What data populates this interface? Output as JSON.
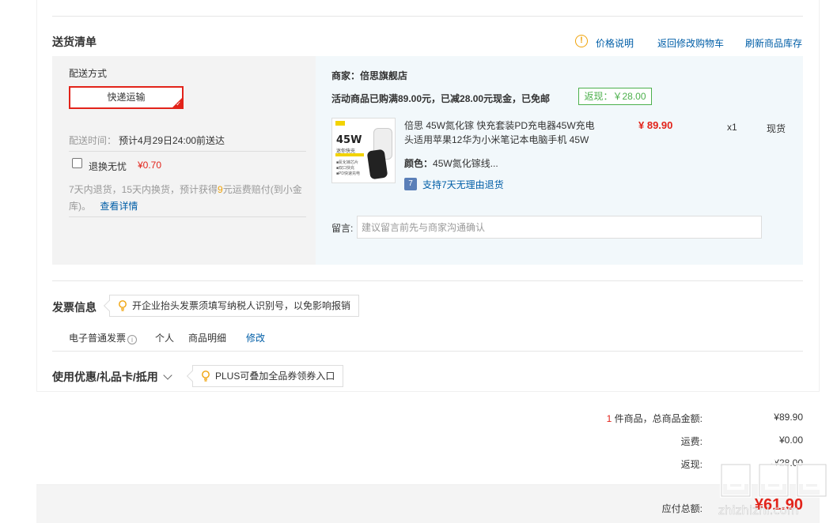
{
  "delivery": {
    "title": "送货清单",
    "price_info": "价格说明",
    "back_to_cart": "返回修改购物车",
    "refresh_stock": "刷新商品库存",
    "method_label": "配送方式",
    "method_selected": "快递运输",
    "time_label": "配送时间：",
    "time_value": "预计4月29日24:00前送达",
    "worry_free_label": "退换无忧",
    "worry_free_price": "¥0.70",
    "worry_free_desc_a": "7天内退货，15天内换货，预计获得",
    "worry_free_desc_num": "9",
    "worry_free_desc_b": "元运费赔付(到小金库)。",
    "see_detail": "查看详情"
  },
  "shop": {
    "merchant_label": "商家：",
    "merchant_name": "倍思旗舰店",
    "promo": "活动商品已购满89.00元，已减28.00元现金，已免邮",
    "rebate": "返现：￥28.00"
  },
  "product": {
    "thumb_text": "45W",
    "thumb_sub": "迷你快充",
    "thumb_bullets": [
      "■氮化镓芯片",
      "■双口快充",
      "■PD快速充电"
    ],
    "name": "倍思 45W氮化镓 快充套装PD充电器45W充电头适用苹果12华为小米笔记本电脑手机 45W",
    "color_label": "颜色：",
    "color_value": "45W氮化镓线...",
    "support_icon": "7",
    "support_text": "支持7天无理由退货",
    "price": "¥ 89.90",
    "quantity": "x1",
    "stock": "现货"
  },
  "message": {
    "label": "留言:",
    "placeholder": "建议留言前先与商家沟通确认"
  },
  "invoice": {
    "title": "发票信息",
    "tip": "开企业抬头发票须填写纳税人识别号，以免影响报销",
    "type": "电子普通发票",
    "person": "个人",
    "detail": "商品明细",
    "modify": "修改"
  },
  "coupon": {
    "title": "使用优惠/礼品卡/抵用",
    "tip": "PLUS可叠加全品券领券入口"
  },
  "summary": {
    "count": "1",
    "count_label": "件商品，总商品金额:",
    "total_goods": "¥89.90",
    "shipping_label": "运费:",
    "shipping": "¥0.00",
    "rebate_label": "返现:",
    "rebate": "-¥28.00",
    "payable_label": "应付总额:",
    "payable": "¥61.90"
  },
  "watermark": {
    "text": "zhizhizhi.com"
  },
  "colors": {
    "accent_red": "#e2231a",
    "link_blue": "#005ea7",
    "rebate_green": "#4cb04c",
    "warn_orange": "#f0a30a"
  }
}
